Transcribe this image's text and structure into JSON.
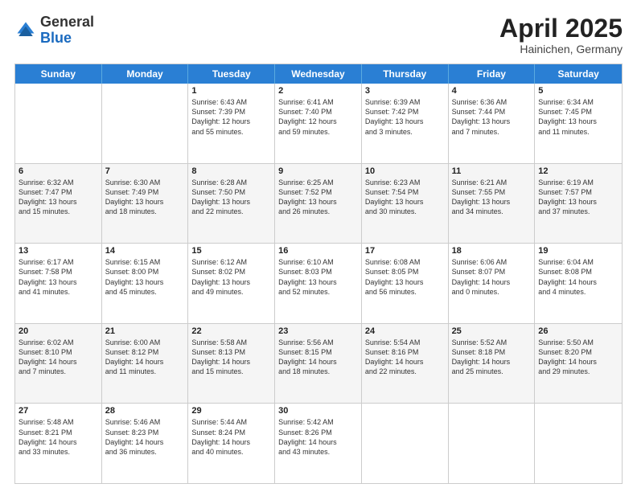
{
  "header": {
    "logo_general": "General",
    "logo_blue": "Blue",
    "month": "April 2025",
    "location": "Hainichen, Germany"
  },
  "days_of_week": [
    "Sunday",
    "Monday",
    "Tuesday",
    "Wednesday",
    "Thursday",
    "Friday",
    "Saturday"
  ],
  "weeks": [
    [
      {
        "day": "",
        "lines": []
      },
      {
        "day": "",
        "lines": []
      },
      {
        "day": "1",
        "lines": [
          "Sunrise: 6:43 AM",
          "Sunset: 7:39 PM",
          "Daylight: 12 hours",
          "and 55 minutes."
        ]
      },
      {
        "day": "2",
        "lines": [
          "Sunrise: 6:41 AM",
          "Sunset: 7:40 PM",
          "Daylight: 12 hours",
          "and 59 minutes."
        ]
      },
      {
        "day": "3",
        "lines": [
          "Sunrise: 6:39 AM",
          "Sunset: 7:42 PM",
          "Daylight: 13 hours",
          "and 3 minutes."
        ]
      },
      {
        "day": "4",
        "lines": [
          "Sunrise: 6:36 AM",
          "Sunset: 7:44 PM",
          "Daylight: 13 hours",
          "and 7 minutes."
        ]
      },
      {
        "day": "5",
        "lines": [
          "Sunrise: 6:34 AM",
          "Sunset: 7:45 PM",
          "Daylight: 13 hours",
          "and 11 minutes."
        ]
      }
    ],
    [
      {
        "day": "6",
        "lines": [
          "Sunrise: 6:32 AM",
          "Sunset: 7:47 PM",
          "Daylight: 13 hours",
          "and 15 minutes."
        ]
      },
      {
        "day": "7",
        "lines": [
          "Sunrise: 6:30 AM",
          "Sunset: 7:49 PM",
          "Daylight: 13 hours",
          "and 18 minutes."
        ]
      },
      {
        "day": "8",
        "lines": [
          "Sunrise: 6:28 AM",
          "Sunset: 7:50 PM",
          "Daylight: 13 hours",
          "and 22 minutes."
        ]
      },
      {
        "day": "9",
        "lines": [
          "Sunrise: 6:25 AM",
          "Sunset: 7:52 PM",
          "Daylight: 13 hours",
          "and 26 minutes."
        ]
      },
      {
        "day": "10",
        "lines": [
          "Sunrise: 6:23 AM",
          "Sunset: 7:54 PM",
          "Daylight: 13 hours",
          "and 30 minutes."
        ]
      },
      {
        "day": "11",
        "lines": [
          "Sunrise: 6:21 AM",
          "Sunset: 7:55 PM",
          "Daylight: 13 hours",
          "and 34 minutes."
        ]
      },
      {
        "day": "12",
        "lines": [
          "Sunrise: 6:19 AM",
          "Sunset: 7:57 PM",
          "Daylight: 13 hours",
          "and 37 minutes."
        ]
      }
    ],
    [
      {
        "day": "13",
        "lines": [
          "Sunrise: 6:17 AM",
          "Sunset: 7:58 PM",
          "Daylight: 13 hours",
          "and 41 minutes."
        ]
      },
      {
        "day": "14",
        "lines": [
          "Sunrise: 6:15 AM",
          "Sunset: 8:00 PM",
          "Daylight: 13 hours",
          "and 45 minutes."
        ]
      },
      {
        "day": "15",
        "lines": [
          "Sunrise: 6:12 AM",
          "Sunset: 8:02 PM",
          "Daylight: 13 hours",
          "and 49 minutes."
        ]
      },
      {
        "day": "16",
        "lines": [
          "Sunrise: 6:10 AM",
          "Sunset: 8:03 PM",
          "Daylight: 13 hours",
          "and 52 minutes."
        ]
      },
      {
        "day": "17",
        "lines": [
          "Sunrise: 6:08 AM",
          "Sunset: 8:05 PM",
          "Daylight: 13 hours",
          "and 56 minutes."
        ]
      },
      {
        "day": "18",
        "lines": [
          "Sunrise: 6:06 AM",
          "Sunset: 8:07 PM",
          "Daylight: 14 hours",
          "and 0 minutes."
        ]
      },
      {
        "day": "19",
        "lines": [
          "Sunrise: 6:04 AM",
          "Sunset: 8:08 PM",
          "Daylight: 14 hours",
          "and 4 minutes."
        ]
      }
    ],
    [
      {
        "day": "20",
        "lines": [
          "Sunrise: 6:02 AM",
          "Sunset: 8:10 PM",
          "Daylight: 14 hours",
          "and 7 minutes."
        ]
      },
      {
        "day": "21",
        "lines": [
          "Sunrise: 6:00 AM",
          "Sunset: 8:12 PM",
          "Daylight: 14 hours",
          "and 11 minutes."
        ]
      },
      {
        "day": "22",
        "lines": [
          "Sunrise: 5:58 AM",
          "Sunset: 8:13 PM",
          "Daylight: 14 hours",
          "and 15 minutes."
        ]
      },
      {
        "day": "23",
        "lines": [
          "Sunrise: 5:56 AM",
          "Sunset: 8:15 PM",
          "Daylight: 14 hours",
          "and 18 minutes."
        ]
      },
      {
        "day": "24",
        "lines": [
          "Sunrise: 5:54 AM",
          "Sunset: 8:16 PM",
          "Daylight: 14 hours",
          "and 22 minutes."
        ]
      },
      {
        "day": "25",
        "lines": [
          "Sunrise: 5:52 AM",
          "Sunset: 8:18 PM",
          "Daylight: 14 hours",
          "and 25 minutes."
        ]
      },
      {
        "day": "26",
        "lines": [
          "Sunrise: 5:50 AM",
          "Sunset: 8:20 PM",
          "Daylight: 14 hours",
          "and 29 minutes."
        ]
      }
    ],
    [
      {
        "day": "27",
        "lines": [
          "Sunrise: 5:48 AM",
          "Sunset: 8:21 PM",
          "Daylight: 14 hours",
          "and 33 minutes."
        ]
      },
      {
        "day": "28",
        "lines": [
          "Sunrise: 5:46 AM",
          "Sunset: 8:23 PM",
          "Daylight: 14 hours",
          "and 36 minutes."
        ]
      },
      {
        "day": "29",
        "lines": [
          "Sunrise: 5:44 AM",
          "Sunset: 8:24 PM",
          "Daylight: 14 hours",
          "and 40 minutes."
        ]
      },
      {
        "day": "30",
        "lines": [
          "Sunrise: 5:42 AM",
          "Sunset: 8:26 PM",
          "Daylight: 14 hours",
          "and 43 minutes."
        ]
      },
      {
        "day": "",
        "lines": []
      },
      {
        "day": "",
        "lines": []
      },
      {
        "day": "",
        "lines": []
      }
    ]
  ]
}
